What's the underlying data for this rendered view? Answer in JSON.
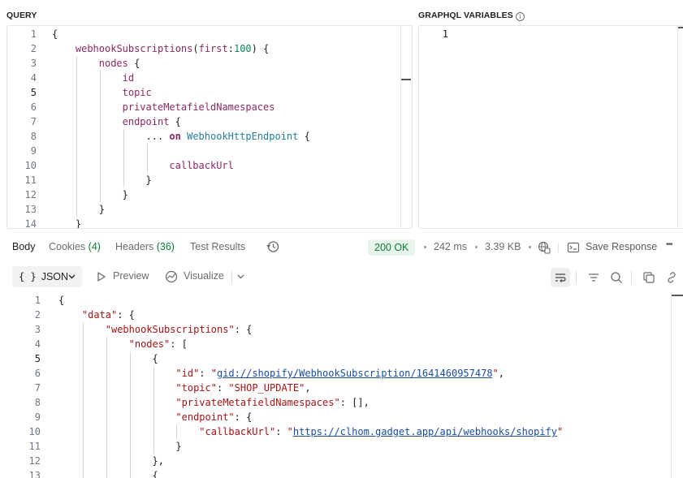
{
  "query_label": "QUERY",
  "variables_label": "GRAPHQL VARIABLES",
  "info_glyph": "i",
  "query_lines": [
    {
      "n": "1",
      "parts": [
        {
          "t": "{",
          "c": "punc"
        }
      ]
    },
    {
      "n": "2",
      "parts": [
        {
          "t": "webhookSubscriptions",
          "c": "field"
        },
        {
          "t": "(",
          "c": "punc"
        },
        {
          "t": "first",
          "c": "field"
        },
        {
          "t": ":",
          "c": "punc"
        },
        {
          "t": "100",
          "c": "num"
        },
        {
          "t": ") {",
          "c": "punc"
        }
      ]
    },
    {
      "n": "3",
      "parts": [
        {
          "t": "nodes",
          "c": "field"
        },
        {
          "t": " {",
          "c": "punc"
        }
      ]
    },
    {
      "n": "4",
      "parts": [
        {
          "t": "id",
          "c": "field"
        }
      ]
    },
    {
      "n": "5",
      "parts": [
        {
          "t": "topic",
          "c": "field"
        }
      ]
    },
    {
      "n": "6",
      "parts": [
        {
          "t": "privateMetafieldNamespaces",
          "c": "field"
        }
      ]
    },
    {
      "n": "7",
      "parts": [
        {
          "t": "endpoint",
          "c": "field"
        },
        {
          "t": " {",
          "c": "punc"
        }
      ]
    },
    {
      "n": "8",
      "parts": [
        {
          "t": "... ",
          "c": "punc"
        },
        {
          "t": "on",
          "c": "kw"
        },
        {
          "t": " ",
          "c": "punc"
        },
        {
          "t": "WebhookHttpEndpoint",
          "c": "type"
        },
        {
          "t": " {",
          "c": "punc"
        }
      ]
    },
    {
      "n": "9",
      "parts": []
    },
    {
      "n": "10",
      "parts": [
        {
          "t": "callbackUrl",
          "c": "field"
        }
      ]
    },
    {
      "n": "11",
      "parts": [
        {
          "t": "}",
          "c": "punc"
        }
      ]
    },
    {
      "n": "12",
      "parts": [
        {
          "t": "}",
          "c": "punc"
        }
      ]
    },
    {
      "n": "13",
      "parts": [
        {
          "t": "}",
          "c": "punc"
        }
      ]
    },
    {
      "n": "14",
      "parts": [
        {
          "t": "}",
          "c": "punc"
        }
      ]
    }
  ],
  "variables_lines": [
    {
      "n": "1"
    }
  ],
  "response_tabs": {
    "body": "Body",
    "cookies": "Cookies",
    "cookies_count": "(4)",
    "headers": "Headers",
    "headers_count": "(36)",
    "tests": "Test Results"
  },
  "status": {
    "code": "200 OK",
    "time": "242 ms",
    "size": "3.39 KB",
    "save": "Save Response",
    "more": "•••"
  },
  "body_toolbar": {
    "format_braces": "{ }",
    "format": "JSON",
    "preview": "Preview",
    "visualize": "Visualize"
  },
  "response_lines": [
    {
      "n": "1",
      "parts": [
        {
          "t": "{",
          "c": "punc"
        }
      ]
    },
    {
      "n": "2",
      "parts": [
        {
          "t": "\"data\"",
          "c": "key"
        },
        {
          "t": ": {",
          "c": "punc"
        }
      ]
    },
    {
      "n": "3",
      "parts": [
        {
          "t": "\"webhookSubscriptions\"",
          "c": "key"
        },
        {
          "t": ": {",
          "c": "punc"
        }
      ]
    },
    {
      "n": "4",
      "parts": [
        {
          "t": "\"nodes\"",
          "c": "key"
        },
        {
          "t": ": [",
          "c": "punc"
        }
      ]
    },
    {
      "n": "5",
      "parts": [
        {
          "t": "{",
          "c": "punc"
        }
      ]
    },
    {
      "n": "6",
      "parts": [
        {
          "t": "\"id\"",
          "c": "key"
        },
        {
          "t": ": ",
          "c": "punc"
        },
        {
          "t": "\"",
          "c": "link-q"
        },
        {
          "t": "gid://shopify/WebhookSubscription/1641460957478",
          "c": "link"
        },
        {
          "t": "\"",
          "c": "link-q"
        },
        {
          "t": ",",
          "c": "punc"
        }
      ]
    },
    {
      "n": "7",
      "parts": [
        {
          "t": "\"topic\"",
          "c": "key"
        },
        {
          "t": ": ",
          "c": "punc"
        },
        {
          "t": "\"SHOP_UPDATE\"",
          "c": "str"
        },
        {
          "t": ",",
          "c": "punc"
        }
      ]
    },
    {
      "n": "8",
      "parts": [
        {
          "t": "\"privateMetafieldNamespaces\"",
          "c": "key"
        },
        {
          "t": ": [],",
          "c": "punc"
        }
      ]
    },
    {
      "n": "9",
      "parts": [
        {
          "t": "\"endpoint\"",
          "c": "key"
        },
        {
          "t": ": {",
          "c": "punc"
        }
      ]
    },
    {
      "n": "10",
      "parts": [
        {
          "t": "\"callbackUrl\"",
          "c": "key"
        },
        {
          "t": ": ",
          "c": "punc"
        },
        {
          "t": "\"",
          "c": "link-q"
        },
        {
          "t": "https://clhom.gadget.app/api/webhooks/shopify",
          "c": "link"
        },
        {
          "t": "\"",
          "c": "link-q"
        }
      ]
    },
    {
      "n": "11",
      "parts": [
        {
          "t": "}",
          "c": "punc"
        }
      ]
    },
    {
      "n": "12",
      "parts": [
        {
          "t": "},",
          "c": "punc"
        }
      ]
    },
    {
      "n": "13",
      "parts": [
        {
          "t": "{",
          "c": "punc"
        }
      ]
    }
  ],
  "colors": {
    "status_bg": "#e8f5ea",
    "status_text": "#0b7a3b",
    "field": "#8a2a64",
    "number": "#098658",
    "type": "#267f99",
    "json_key": "#a31515",
    "link": "#1a4d9e"
  },
  "icons": {
    "history": "history-icon",
    "network": "network-globe-icon",
    "save": "save-response-icon",
    "wrap": "word-wrap-icon",
    "filter": "filter-icon",
    "search": "search-icon",
    "copy": "copy-icon",
    "link": "link-icon",
    "preview": "play-icon",
    "visualize": "visualize-icon"
  }
}
